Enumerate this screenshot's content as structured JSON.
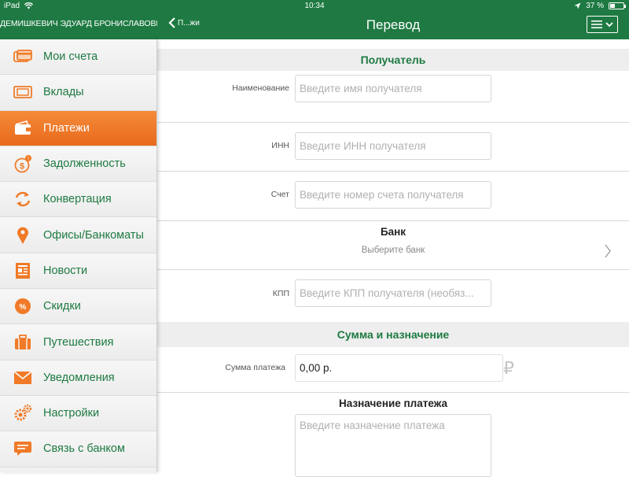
{
  "status_bar": {
    "device": "iPad",
    "time": "10:34",
    "battery": "37 %",
    "battery_level": 0.37
  },
  "header": {
    "user_name": "ДЕМИШКЕВИЧ ЭДУАРД БРОНИСЛАВОВИЧ",
    "back_label": "П...жи",
    "title": "Перевод"
  },
  "sidebar": {
    "items": [
      {
        "label": "Мои счета",
        "icon": "cards-icon"
      },
      {
        "label": "Вклады",
        "icon": "deposit-icon"
      },
      {
        "label": "Платежи",
        "icon": "wallet-icon",
        "active": true
      },
      {
        "label": "Задолженность",
        "icon": "debt-coin-icon"
      },
      {
        "label": "Конвертация",
        "icon": "exchange-arrows-icon"
      },
      {
        "label": "Офисы/Банкоматы",
        "icon": "map-pin-icon"
      },
      {
        "label": "Новости",
        "icon": "newspaper-icon"
      },
      {
        "label": "Скидки",
        "icon": "discount-icon"
      },
      {
        "label": "Путешествия",
        "icon": "suitcase-icon"
      },
      {
        "label": "Уведомления",
        "icon": "envelope-icon"
      },
      {
        "label": "Настройки",
        "icon": "gears-icon"
      },
      {
        "label": "Связь с банком",
        "icon": "chat-icon"
      }
    ]
  },
  "recipient": {
    "section_title": "Получатель",
    "name_label": "Наименование",
    "name_placeholder": "Введите имя получателя",
    "inn_label": "ИНН",
    "inn_placeholder": "Введите ИНН получателя",
    "account_label": "Счет",
    "account_placeholder": "Введите номер счета получателя",
    "bank_title": "Банк",
    "bank_placeholder": "Выберите банк",
    "kpp_label": "КПП",
    "kpp_placeholder": "Введите КПП получателя (необяз..."
  },
  "amount": {
    "section_title": "Сумма и назначение",
    "amount_label": "Сумма платежа",
    "amount_value": "0,00 р.",
    "currency_symbol": "₽",
    "purpose_title": "Назначение платежа",
    "purpose_placeholder": "Введите назначение платежа"
  },
  "colors": {
    "brand_green": "#1e7a42",
    "active_orange": "#f07a28",
    "icon_orange": "#f07a28"
  }
}
